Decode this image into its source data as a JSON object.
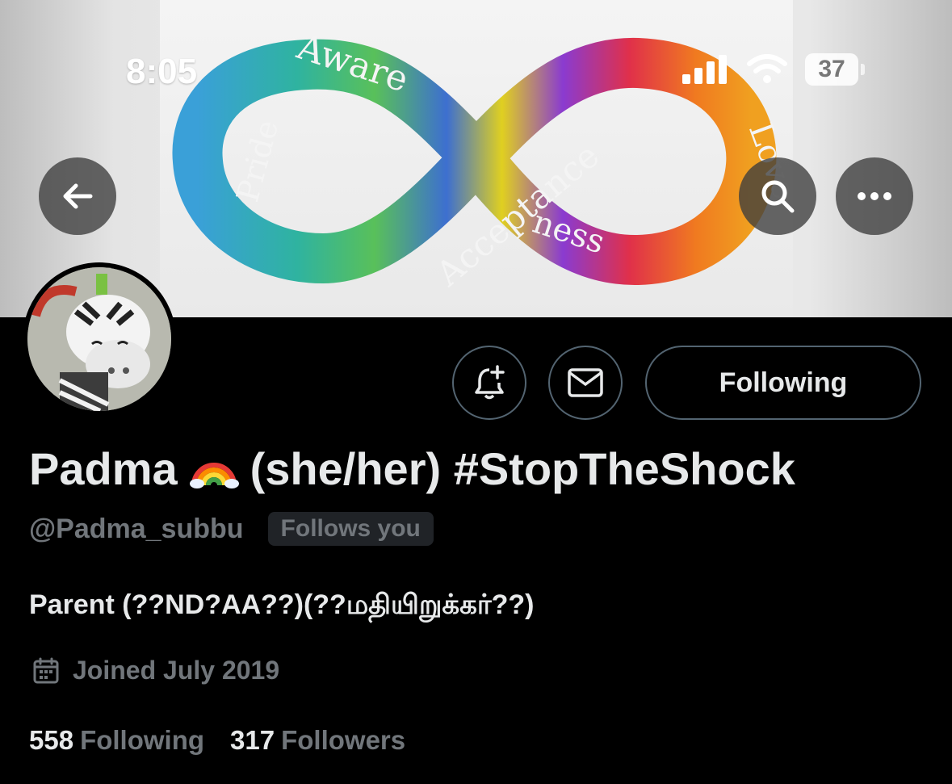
{
  "status_bar": {
    "time": "8:05",
    "battery": "37"
  },
  "banner": {
    "words": [
      "Aware",
      "Acceptance",
      "Love",
      "Pride",
      "ness"
    ]
  },
  "profile": {
    "display_name": "Padma",
    "display_name_suffix": "(she/her) #StopTheShock",
    "name_emoji": "rainbow",
    "handle": "@Padma_subbu",
    "follows_you": "Follows you",
    "bio": "Parent (??ND?AA??)(??மதியிறுக்கர்??)",
    "joined": "Joined July 2019",
    "following_count": "558",
    "following_label": "Following",
    "followers_count": "317",
    "followers_label": "Followers"
  },
  "actions": {
    "follow_state_label": "Following"
  },
  "icons": [
    "back-arrow-icon",
    "search-icon",
    "more-icon",
    "notification-bell-icon",
    "message-icon",
    "calendar-icon",
    "signal-icon",
    "wifi-icon",
    "battery-icon"
  ],
  "colors": {
    "background": "#000000",
    "primary_text": "#e7e9ea",
    "secondary_text": "#71767b",
    "border": "#536471"
  }
}
